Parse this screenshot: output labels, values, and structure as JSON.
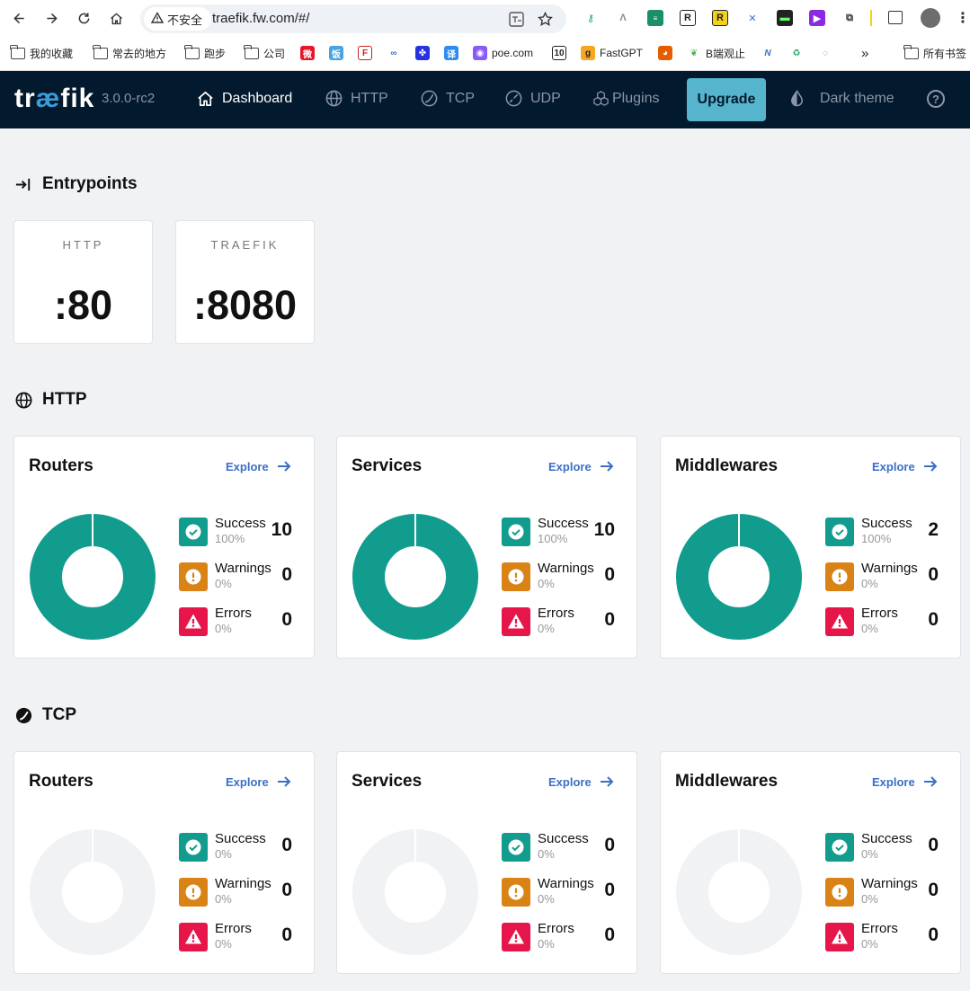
{
  "browser": {
    "security_label": "不安全",
    "url": "traefik.fw.com/#/",
    "bookmarks": [
      {
        "label": "我的收藏",
        "icon": "folder-icon"
      },
      {
        "label": "常去的地方",
        "icon": "folder-icon"
      },
      {
        "label": "跑步",
        "icon": "folder-icon"
      },
      {
        "label": "公司",
        "icon": "folder-icon"
      },
      {
        "label": "poe.com",
        "icon": "poe-icon"
      },
      {
        "label": "FastGPT",
        "icon": "fastgpt-icon"
      },
      {
        "label": "B端观止",
        "icon": "leaf-icon"
      },
      {
        "label": "所有书签",
        "icon": "folder-icon"
      }
    ]
  },
  "nav": {
    "logo_left": "tr",
    "logo_ae": "æ",
    "logo_right": "fik",
    "version": "3.0.0-rc2",
    "items": [
      "Dashboard",
      "HTTP",
      "TCP",
      "UDP",
      "Plugins"
    ],
    "upgrade": "Upgrade",
    "theme": "Dark theme",
    "help": "?"
  },
  "entrypoints": {
    "title": "Entrypoints",
    "items": [
      {
        "name": "HTTP",
        "value": ":80"
      },
      {
        "name": "TRAEFIK",
        "value": ":8080"
      }
    ]
  },
  "http": {
    "title": "HTTP",
    "cards": [
      {
        "title": "Routers",
        "explore": "Explore",
        "success": {
          "label": "Success",
          "percent": "100%",
          "count": "10"
        },
        "warnings": {
          "label": "Warnings",
          "percent": "0%",
          "count": "0"
        },
        "errors": {
          "label": "Errors",
          "percent": "0%",
          "count": "0"
        }
      },
      {
        "title": "Services",
        "explore": "Explore",
        "success": {
          "label": "Success",
          "percent": "100%",
          "count": "10"
        },
        "warnings": {
          "label": "Warnings",
          "percent": "0%",
          "count": "0"
        },
        "errors": {
          "label": "Errors",
          "percent": "0%",
          "count": "0"
        }
      },
      {
        "title": "Middlewares",
        "explore": "Explore",
        "success": {
          "label": "Success",
          "percent": "100%",
          "count": "2"
        },
        "warnings": {
          "label": "Warnings",
          "percent": "0%",
          "count": "0"
        },
        "errors": {
          "label": "Errors",
          "percent": "0%",
          "count": "0"
        }
      }
    ]
  },
  "tcp": {
    "title": "TCP",
    "cards": [
      {
        "title": "Routers",
        "explore": "Explore",
        "success": {
          "label": "Success",
          "percent": "0%",
          "count": "0"
        },
        "warnings": {
          "label": "Warnings",
          "percent": "0%",
          "count": "0"
        },
        "errors": {
          "label": "Errors",
          "percent": "0%",
          "count": "0"
        }
      },
      {
        "title": "Services",
        "explore": "Explore",
        "success": {
          "label": "Success",
          "percent": "0%",
          "count": "0"
        },
        "warnings": {
          "label": "Warnings",
          "percent": "0%",
          "count": "0"
        },
        "errors": {
          "label": "Errors",
          "percent": "0%",
          "count": "0"
        }
      },
      {
        "title": "Middlewares",
        "explore": "Explore",
        "success": {
          "label": "Success",
          "percent": "0%",
          "count": "0"
        },
        "warnings": {
          "label": "Warnings",
          "percent": "0%",
          "count": "0"
        },
        "errors": {
          "label": "Errors",
          "percent": "0%",
          "count": "0"
        }
      }
    ]
  },
  "colors": {
    "success": "#119c8d",
    "warning": "#d98317",
    "error": "#e6154a",
    "empty": "#f0f2f4",
    "nav_bg": "#03192d",
    "upgrade": "#56b5cd",
    "link": "#3a6fc6"
  }
}
